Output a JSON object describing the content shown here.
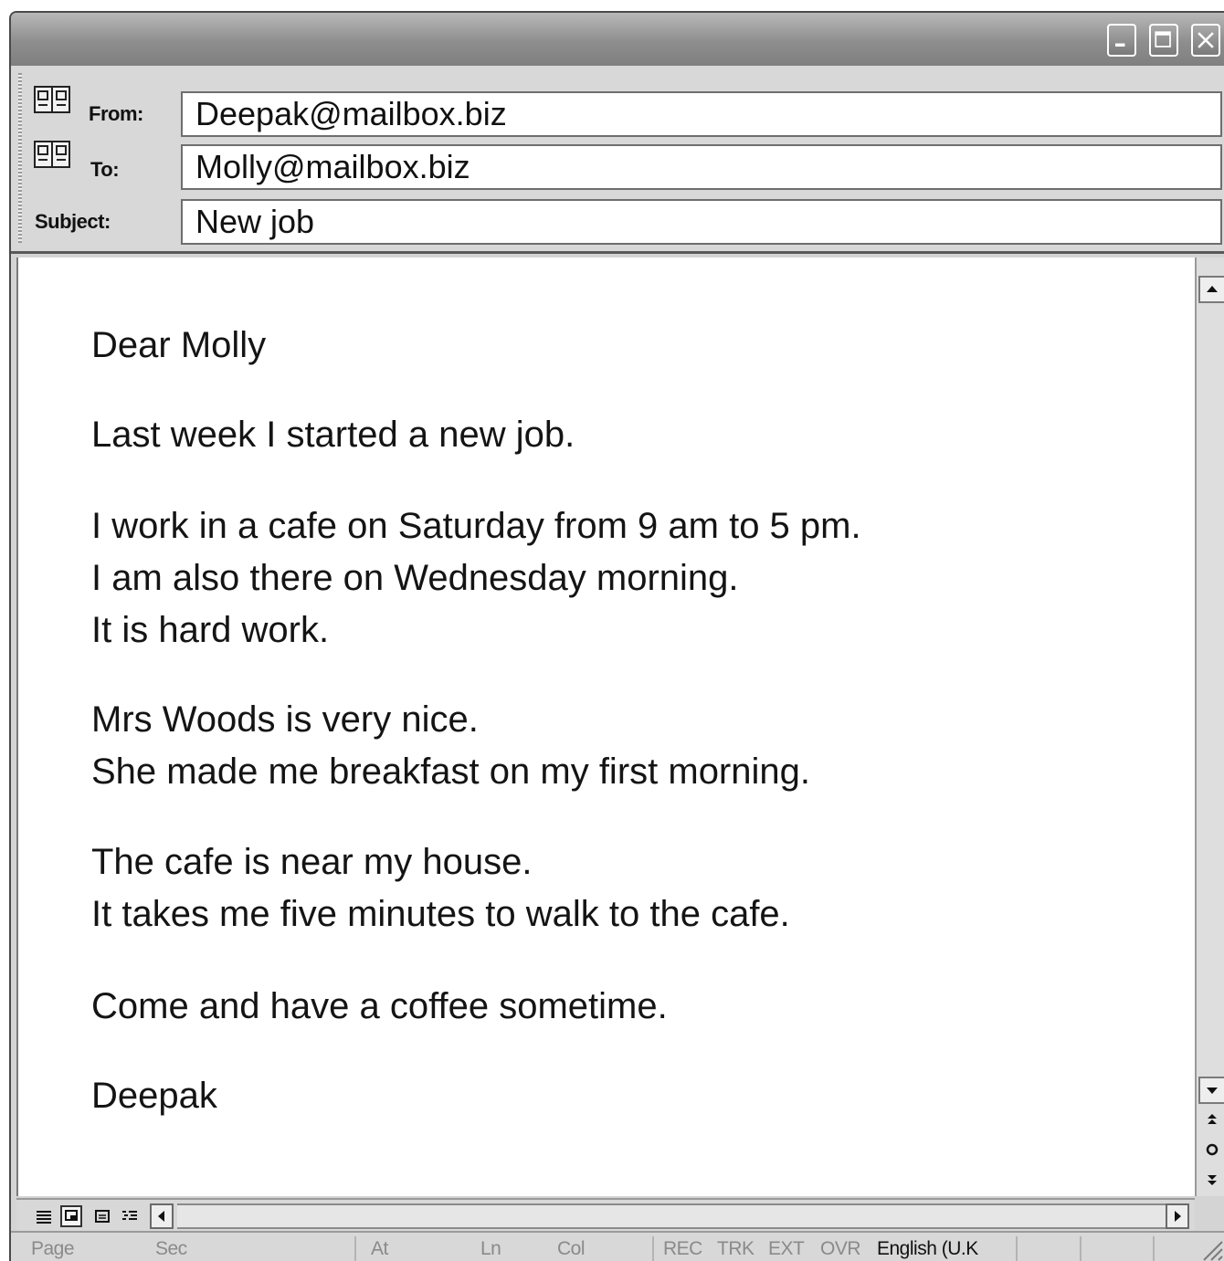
{
  "window": {
    "controls": {
      "minimize_icon": "minimize-icon",
      "maximize_icon": "maximize-icon",
      "close_icon": "close-icon"
    }
  },
  "header": {
    "from_label": "From:",
    "from_value": "Deepak@mailbox.biz",
    "to_label": "To:",
    "to_value": "Molly@mailbox.biz",
    "subject_label": "Subject:",
    "subject_value": "New job",
    "address_book_icon": "address-book-icon"
  },
  "body": {
    "paragraphs": [
      {
        "lines": [
          "Dear Molly"
        ]
      },
      {
        "lines": [
          "Last week I started a new job."
        ]
      },
      {
        "lines": [
          "I work in a cafe on Saturday from 9 am to 5 pm.",
          "I am also there on Wednesday morning.",
          "It is hard work."
        ]
      },
      {
        "lines": [
          "Mrs Woods is very nice.",
          "She made me breakfast on my first morning."
        ]
      },
      {
        "lines": [
          "The cafe is near my house.",
          "It takes me five minutes to walk to the cafe."
        ]
      },
      {
        "lines": [
          "Come and have a coffee sometime."
        ]
      },
      {
        "lines": [
          "Deepak"
        ]
      }
    ]
  },
  "statusbar": {
    "page": "Page",
    "sec": "Sec",
    "at": "At",
    "ln": "Ln",
    "col": "Col",
    "rec": "REC",
    "trk": "TRK",
    "ext": "EXT",
    "ovr": "OVR",
    "language": "English (U.K"
  },
  "colors": {
    "chrome": "#d8d8d8",
    "titlebar": "#8e8e8e",
    "text": "#141414",
    "disabled_status": "#8a8a8a"
  }
}
